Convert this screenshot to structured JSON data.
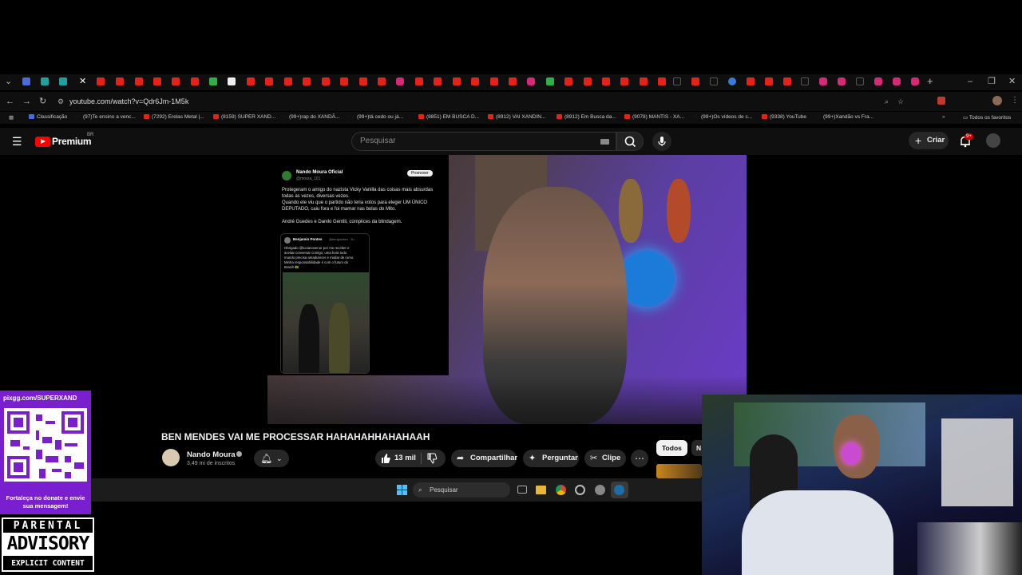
{
  "browser": {
    "url": "youtube.com/watch?v=Qdr6Jm-1M5k",
    "bookmarks": [
      {
        "label": "Classificação",
        "color": "#4b6bd6"
      },
      {
        "label": "(97)Te ensino a venc...",
        "color": "#111"
      },
      {
        "label": "(7292) Erelas Metal |...",
        "color": "#e62117"
      },
      {
        "label": "(8159) SUPER XAND...",
        "color": "#e62117"
      },
      {
        "label": "(99+)rap do XANDÃ...",
        "color": "#111"
      },
      {
        "label": "(99+)tá cedo ou já...",
        "color": "#111"
      },
      {
        "label": "(8851) EM BUSCA D...",
        "color": "#e62117"
      },
      {
        "label": "(8912) VAI XANDIN...",
        "color": "#e62117"
      },
      {
        "label": "(8912) Em Busca da...",
        "color": "#e62117"
      },
      {
        "label": "(9078) MANTIS - XA...",
        "color": "#e62117"
      },
      {
        "label": "(99+)Os vídeos de c...",
        "color": "#111"
      },
      {
        "label": "(9338) YouTube",
        "color": "#e62117"
      },
      {
        "label": "(99+)Xandão vs Fra...",
        "color": "#111"
      }
    ],
    "all_bookmarks_label": "Todos os favoritos"
  },
  "youtube": {
    "logo_text": "Premium",
    "logo_badge": "BR",
    "search_placeholder": "Pesquisar",
    "create_label": "Criar",
    "notification_count": "9+",
    "video": {
      "title": "BEN MENDES VAI ME PROCESSAR HAHAHAHHAHAHAAH",
      "channel_name": "Nando Moura",
      "subscribers": "3,49 mi de inscritos",
      "likes": "13 mil",
      "share_label": "Compartilhar",
      "ask_label": "Perguntar",
      "clip_label": "Clipe",
      "filter_all": "Todos",
      "filter_next": "N"
    },
    "tweet": {
      "author": "Nando Moura Oficial",
      "handle": "@moura_101",
      "promote_label": "Promover",
      "lines": [
        "Protegeram o amigo do nazista Vicky Vanilla das coisas mais absurdas",
        "todas as vezes, diversas vezes.",
        "Quando ele viu que o partido não teria votos para eleger UM ÚNICO",
        "DEPUTADO, caiu fora e foi mamar nas bolas do Mito.",
        "",
        "André Guedes e Danilo Gentili, cúmplices da blindagem."
      ],
      "quoted_author": "Benjamin Pontes",
      "quoted_handle": "@benjpontes · 1h",
      "quoted_lines": [
        "Obrigado @lucianovenor por me receber e",
        "aceitar conversar comigo, uma hora todo",
        "mundo precisa amadurecer e mudar de rumo.",
        "Minha responsabilidade é com o futuro do",
        "Brasil! 🇧🇷"
      ]
    }
  },
  "taskbar": {
    "search_placeholder": "Pesquisar"
  },
  "overlays": {
    "pix_url": "pixgg.com/SUPERXAND",
    "pix_message": "Fortaleça no donate e envie sua mensagem!",
    "advisory_line1": "PARENTAL",
    "advisory_line2": "ADVISORY",
    "advisory_line3": "EXPLICIT CONTENT"
  },
  "colors": {
    "youtube_red": "#ff0000",
    "pix_purple": "#7a1fd0",
    "page_bg": "#0f0f0f"
  }
}
